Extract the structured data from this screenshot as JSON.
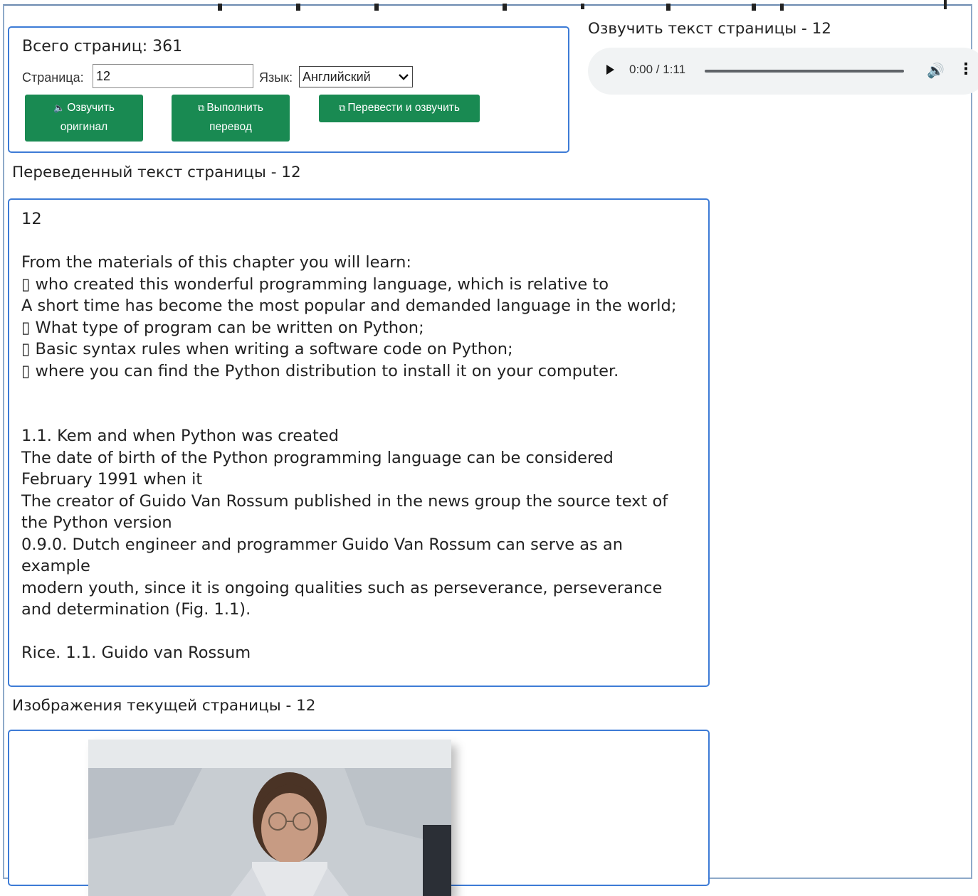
{
  "control_panel": {
    "total_pages": "Всего страниц: 361",
    "page_label": "Страница:",
    "page_value": "12",
    "lang_label": "Язык:",
    "lang_selected": "Английский",
    "btn_speak_original": [
      "Озвучить",
      "оригинал"
    ],
    "btn_translate": [
      "Выполнить",
      "перевод"
    ],
    "btn_translate_speak": "Перевести и озвучить"
  },
  "audio": {
    "heading": "Озвучить текст страницы - 12",
    "time": "0:00 / 1:11"
  },
  "translated": {
    "heading": "Переведенный текст страницы - 12",
    "lines": [
      "12",
      "",
      "From the materials of this chapter you will learn:",
      "▯ who created this wonderful programming language, which is relative to",
      "A short time has become the most popular and demanded language in the world;",
      "▯ What type of program can be written on Python;",
      "▯ Basic syntax rules when writing a software code on Python;",
      "▯ where you can find the Python distribution to install it on your computer.",
      "",
      "",
      "1.1. Kem and when Python was created",
      "The date of birth of the Python programming language can be considered",
      "February 1991 when it",
      "The creator of Guido Van Rossum published in the news group the source text of",
      "the Python version",
      "0.9.0. Dutch engineer and programmer Guido Van Rossum can serve as an",
      "example",
      "modern youth, since it is ongoing qualities such as perseverance, perseverance",
      "and determination (Fig. 1.1).",
      "",
      "Rice. 1.1. Guido van Rossum"
    ]
  },
  "images": {
    "heading": "Изображения текущей страницы - 12"
  }
}
